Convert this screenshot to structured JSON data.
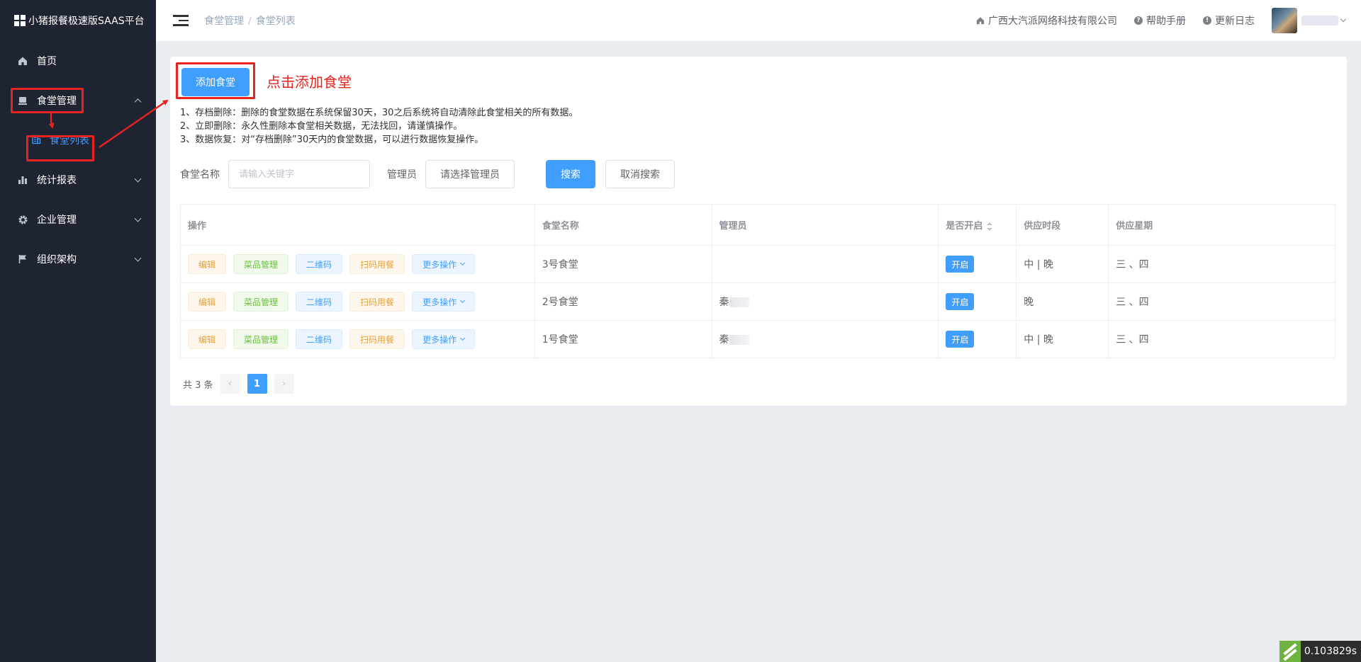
{
  "app": {
    "title": "小猪报餐极速版SAAS平台"
  },
  "sidebar": {
    "items": [
      {
        "label": "首页",
        "icon": "home-icon"
      },
      {
        "label": "食堂管理",
        "icon": "canteen-icon"
      },
      {
        "label": "统计报表",
        "icon": "chart-icon"
      },
      {
        "label": "企业管理",
        "icon": "gear-icon"
      },
      {
        "label": "组织架构",
        "icon": "flag-icon"
      }
    ],
    "submenu": {
      "label": "食堂列表",
      "icon": "building-icon"
    }
  },
  "header": {
    "breadcrumb": [
      "食堂管理",
      "食堂列表"
    ],
    "company": "广西大汽派网络科技有限公司",
    "help": "帮助手册",
    "changelog": "更新日志"
  },
  "main": {
    "add_button": "添加食堂",
    "annotation": "点击添加食堂",
    "notes": [
      "1、存档删除：删除的食堂数据在系统保留30天，30之后系统将自动清除此食堂相关的所有数据。",
      "2、立即删除：永久性删除本食堂相关数据，无法找回，请谨慎操作。",
      "3、数据恢复：对“存档删除”30天内的食堂数据，可以进行数据恢复操作。"
    ],
    "search": {
      "name_label": "食堂名称",
      "name_placeholder": "请输入关键字",
      "admin_label": "管理员",
      "admin_select": "请选择管理员",
      "search_button": "搜索",
      "cancel_button": "取消搜索"
    },
    "table": {
      "headers": [
        "操作",
        "食堂名称",
        "管理员",
        "是否开启",
        "供应时段",
        "供应星期"
      ],
      "actions": [
        "编辑",
        "菜品管理",
        "二维码",
        "扫码用餐",
        "更多操作"
      ],
      "rows": [
        {
          "name": "3号食堂",
          "admin": "",
          "status": "开启",
          "period": "中 | 晚",
          "weekdays": "三 、四"
        },
        {
          "name": "2号食堂",
          "admin": "秦",
          "status": "开启",
          "period": "晚",
          "weekdays": "三 、四"
        },
        {
          "name": "1号食堂",
          "admin": "秦",
          "status": "开启",
          "period": "中 | 晚",
          "weekdays": "三 、四"
        }
      ]
    },
    "pagination": {
      "total": "共 3 条",
      "current": "1"
    }
  },
  "timer": "0.103829s",
  "colors": {
    "primary": "#409eff",
    "sidebar": "#1f2432",
    "annotation": "#e8231f"
  }
}
